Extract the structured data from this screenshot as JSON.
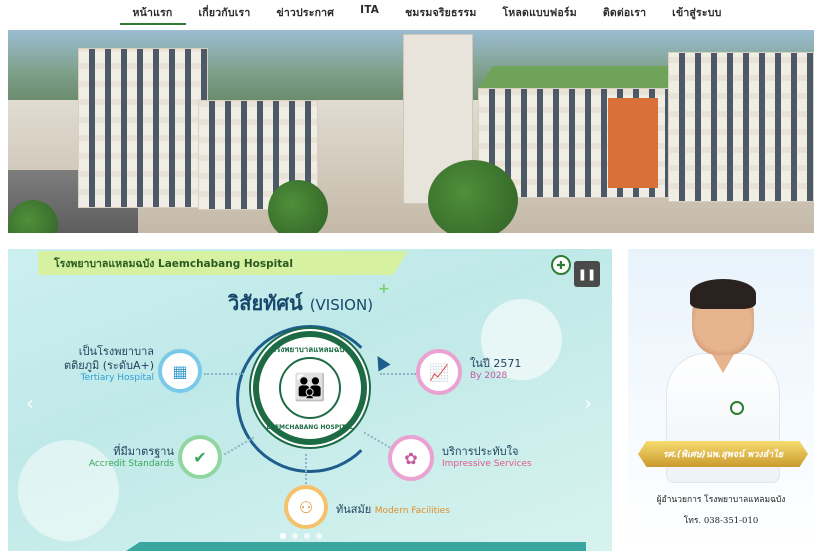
{
  "nav": {
    "items": [
      "หน้าแรก",
      "เกี่ยวกับเรา",
      "ข่าวประกาศ",
      "ITA",
      "ชมรมจริยธรรม",
      "โหลดแบบฟอร์ม",
      "ติดต่อเรา",
      "เข้าสู่ระบบ"
    ]
  },
  "slide": {
    "banner": "โรงพยาบาลแหลมฉบัง Laemchabang Hospital",
    "title_th": "วิสัยทัศน์",
    "title_en": "(VISION)",
    "center_top": "โรงพยาบาลแหลมฉบัง",
    "center_bottom": "LAEMCHABANG HOSPITAL",
    "items": [
      {
        "th": "เป็นโรงพยาบาล ตติยภูมิ (ระดับA+)",
        "en": "Tertiary Hospital"
      },
      {
        "th": "ที่มีมาตรฐาน",
        "en": "Accredit Standards"
      },
      {
        "th": "ทันสมัย",
        "en": "Modern Facilities"
      },
      {
        "th": "บริการประทับใจ",
        "en": "Impressive Services"
      },
      {
        "th": "ในปี 2571",
        "en": "By 2028"
      }
    ]
  },
  "director": {
    "name": "รศ.(พิเศษ)นพ.สุพจน์ พวงลำไย",
    "title": "ผู้อำนวยการ โรงพยาบาลแหลมฉบัง",
    "phone": "โทร. 038-351-010"
  },
  "icons": {
    "pause": "pause-icon",
    "prev": "chevron-left-icon",
    "next": "chevron-right-icon"
  },
  "colors": {
    "accent": "#2e7d32",
    "vision_title": "#17476b"
  }
}
